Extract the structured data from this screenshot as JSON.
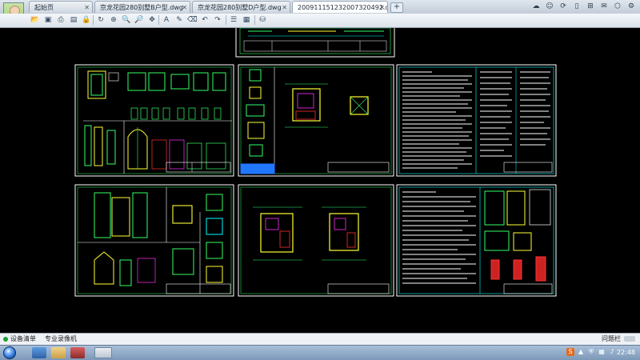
{
  "tabs": [
    {
      "label": "起始页",
      "active": false
    },
    {
      "label": "京龙花园280别墅B户型.dwg",
      "active": false
    },
    {
      "label": "京龙花园280别墅D户型.dwg",
      "active": false
    },
    {
      "label": "20091115123200732049​2.d...",
      "active": true
    }
  ],
  "bottom_panel": {
    "device_list": "设备清单",
    "professional_recorder": "专业录像机",
    "right_label": "问题栏"
  },
  "taskbar": {
    "clock": "22:48",
    "tray_lang": "S"
  },
  "colors": {
    "cad_background": "#000000",
    "sheet_border": "#ffffff",
    "drawing_green": "#33ff66",
    "drawing_yellow": "#ffff33",
    "drawing_cyan": "#00ffff",
    "drawing_red": "#ff3333",
    "drawing_magenta": "#ff33ff"
  }
}
